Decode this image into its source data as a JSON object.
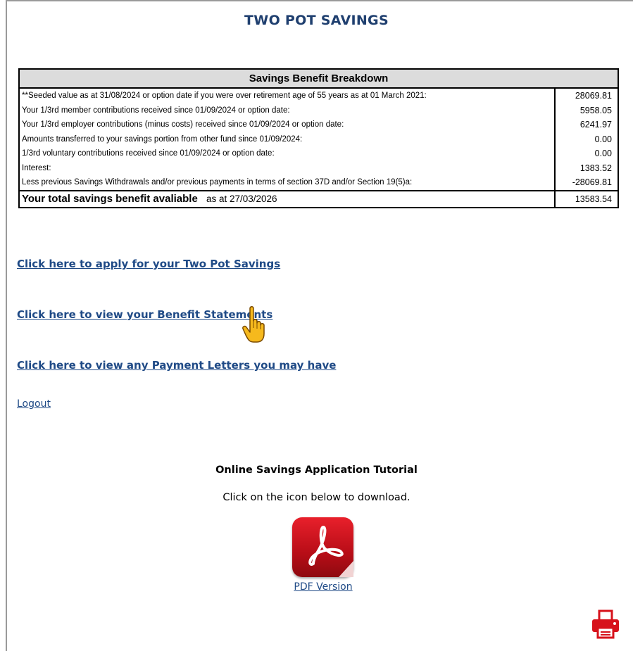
{
  "page": {
    "title": "TWO POT SAVINGS"
  },
  "breakdown": {
    "heading": "Savings Benefit Breakdown",
    "rows": [
      {
        "label": "**Seeded value as at 31/08/2024 or option date if you were over retirement age of 55 years as at 01 March 2021:",
        "amount": "28069.81"
      },
      {
        "label": "Your 1/3rd member contributions received since 01/09/2024 or option date:",
        "amount": "5958.05"
      },
      {
        "label": "Your 1/3rd employer contributions (minus costs) received since 01/09/2024 or option date:",
        "amount": "6241.97"
      },
      {
        "label": "Amounts transferred to your savings portion from other fund since 01/09/2024:",
        "amount": "0.00"
      },
      {
        "label": "1/3rd voluntary contributions received since 01/09/2024 or option date:",
        "amount": "0.00"
      },
      {
        "label": "Interest:",
        "amount": "1383.52"
      },
      {
        "label": "Less previous Savings Withdrawals and/or previous payments in terms of section 37D and/or Section 19(5)a:",
        "amount": "-28069.81"
      }
    ],
    "total": {
      "label": "Your total savings benefit avaliable",
      "as_at": "as at 27/03/2026",
      "amount": "13583.54"
    }
  },
  "links": {
    "apply": "Click here to apply for your Two Pot Savings",
    "statements": "Click here to view your Benefit Statements",
    "payment_letters": "Click here to view any Payment Letters you may have",
    "logout": "Logout"
  },
  "tutorial": {
    "title": "Online Savings Application Tutorial",
    "instruction": "Click on the icon below to download.",
    "pdf_label": "PDF Version"
  },
  "icons": {
    "pdf": "pdf-icon",
    "printer": "printer-icon",
    "cursor": "hand-pointer-cursor-icon"
  },
  "colors": {
    "title": "#1f3f6f",
    "link": "#1f4a86",
    "pdf_red": "#d4141e",
    "printer_red": "#d7121b"
  }
}
